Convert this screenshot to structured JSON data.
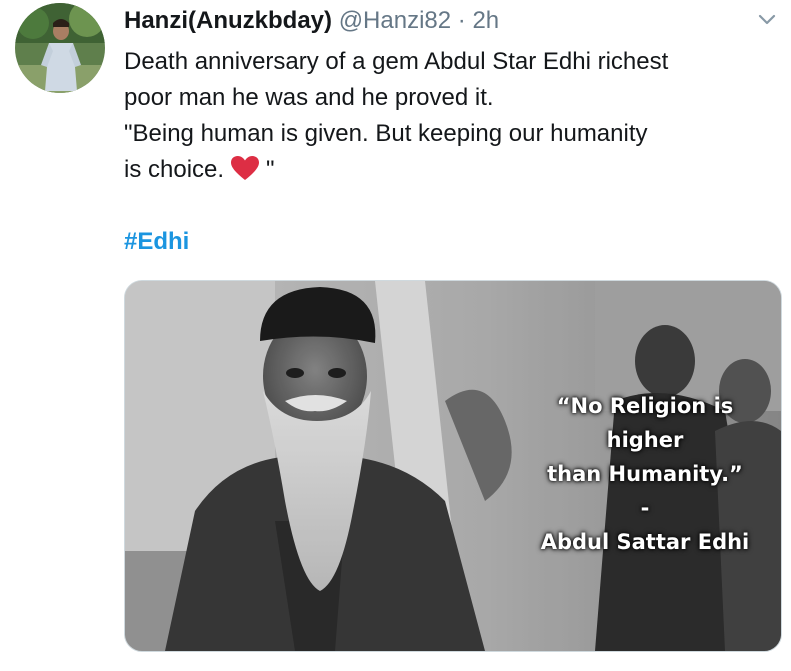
{
  "tweet": {
    "author_name": "Hanzi(Anuzkbday)",
    "handle": "@Hanzi82",
    "separator": "·",
    "time": "2h",
    "text_lines": [
      "Death anniversary of a gem Abdul Star Edhi richest",
      "poor man he was and he proved it.",
      "\"Being human is given. But keeping our humanity",
      "is choice."
    ],
    "text_end": "\"",
    "emoji": "heart-icon",
    "hashtag": "#Edhi"
  },
  "media": {
    "quote_lines": [
      "“No Religion is",
      "higher",
      "than Humanity.”",
      "-",
      "Abdul Sattar Edhi"
    ]
  },
  "colors": {
    "link": "#1b95e0",
    "secondary_text": "#657786",
    "heart": "#e0245e"
  }
}
